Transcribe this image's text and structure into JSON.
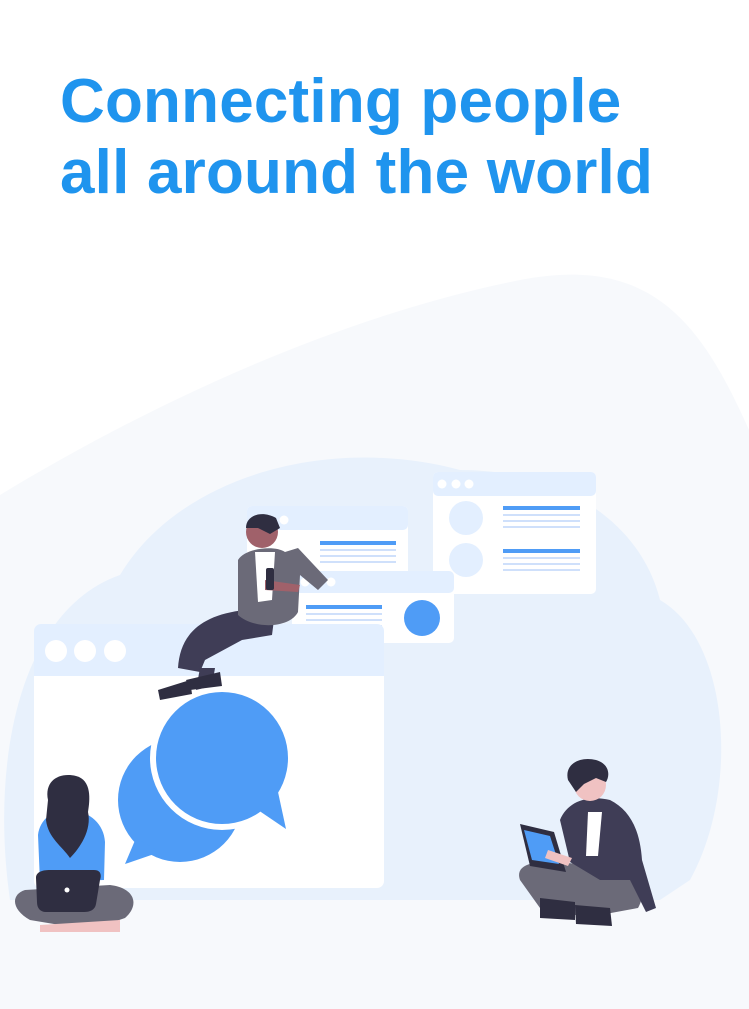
{
  "headline": {
    "line1": "Connecting people",
    "line2": "all around the world"
  },
  "colors": {
    "headline": "#1f94ee",
    "accent": "#4f9cf6",
    "panel": "#e3efff",
    "blob_light": "#f7f9fc",
    "blob_mid": "#e8f1fc"
  },
  "illustration": {
    "icons": [
      "speech-bubbles-icon",
      "browser-window-icon",
      "laptop-icon",
      "tablet-icon"
    ]
  }
}
